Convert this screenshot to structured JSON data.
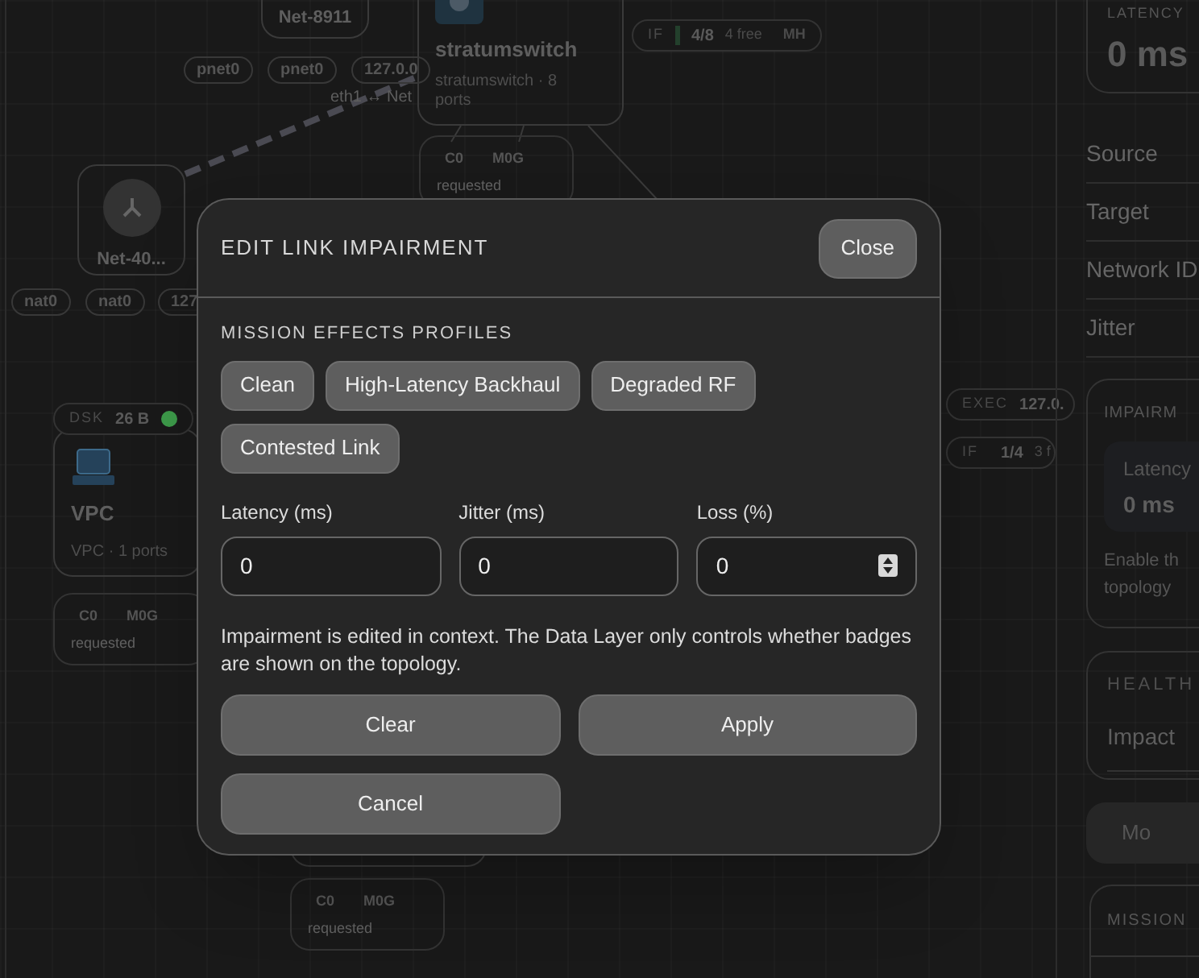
{
  "topology": {
    "nodes": [
      {
        "kind": "label",
        "title": "Net-8911"
      },
      {
        "kind": "switch",
        "title": "stratumswitch",
        "subtitle": "stratumswitch · 8 ports"
      },
      {
        "kind": "network",
        "title": "Net-40..."
      },
      {
        "kind": "host",
        "title": "VPC",
        "subtitle": "VPC · 1 ports"
      }
    ],
    "chips": [
      "pnet0",
      "pnet0",
      "127.0.0",
      "nat0",
      "nat0",
      "127"
    ],
    "link_labels": [
      "eth1 ↔ Net"
    ],
    "resource_cards": [
      {
        "cpu": "C0",
        "memory": "M0G",
        "status": "requested"
      },
      {
        "cpu": "C0",
        "memory": "M0G",
        "status": "requested"
      },
      {
        "cpu": "C0",
        "memory": "M0G",
        "status": "requested"
      }
    ],
    "pills": [
      {
        "kind": "interfaces",
        "label": "IF",
        "value": "4/8",
        "detail": "4 free",
        "extra": "MH"
      },
      {
        "kind": "disk",
        "label": "DSK",
        "value": "26 B",
        "color": "#3d9a4a"
      },
      {
        "kind": "exec",
        "label": "EXEC",
        "value": "127.0."
      },
      {
        "kind": "interfaces",
        "label": "IF",
        "value": "1/4",
        "detail": "3 f"
      }
    ]
  },
  "sidebar": {
    "latency_card": {
      "label": "LATENCY",
      "value": "0 ms"
    },
    "rows": [
      "Source",
      "Target",
      "Network ID",
      "Jitter"
    ],
    "impairment_card": {
      "title": "IMPAIRM",
      "tile_label": "Latency",
      "tile_value": "0 ms",
      "text": "Enable th topology"
    },
    "health_card": {
      "title": "HEALTH",
      "row": "Impact"
    },
    "button": "Mo",
    "mission_card": {
      "title": "MISSION"
    }
  },
  "modal": {
    "title": "EDIT LINK IMPAIRMENT",
    "close": "Close",
    "section": "MISSION EFFECTS PROFILES",
    "profiles": [
      "Clean",
      "High-Latency Backhaul",
      "Degraded RF",
      "Contested Link"
    ],
    "fields": [
      {
        "kind": "text",
        "label": "Latency (ms)",
        "value": "0"
      },
      {
        "kind": "text",
        "label": "Jitter (ms)",
        "value": "0"
      },
      {
        "kind": "number",
        "label": "Loss (%)",
        "value": "0"
      }
    ],
    "note": "Impairment is edited in context. The Data Layer only controls whether badges are shown on the topology.",
    "actions": [
      "Clear",
      "Apply",
      "Cancel"
    ]
  }
}
